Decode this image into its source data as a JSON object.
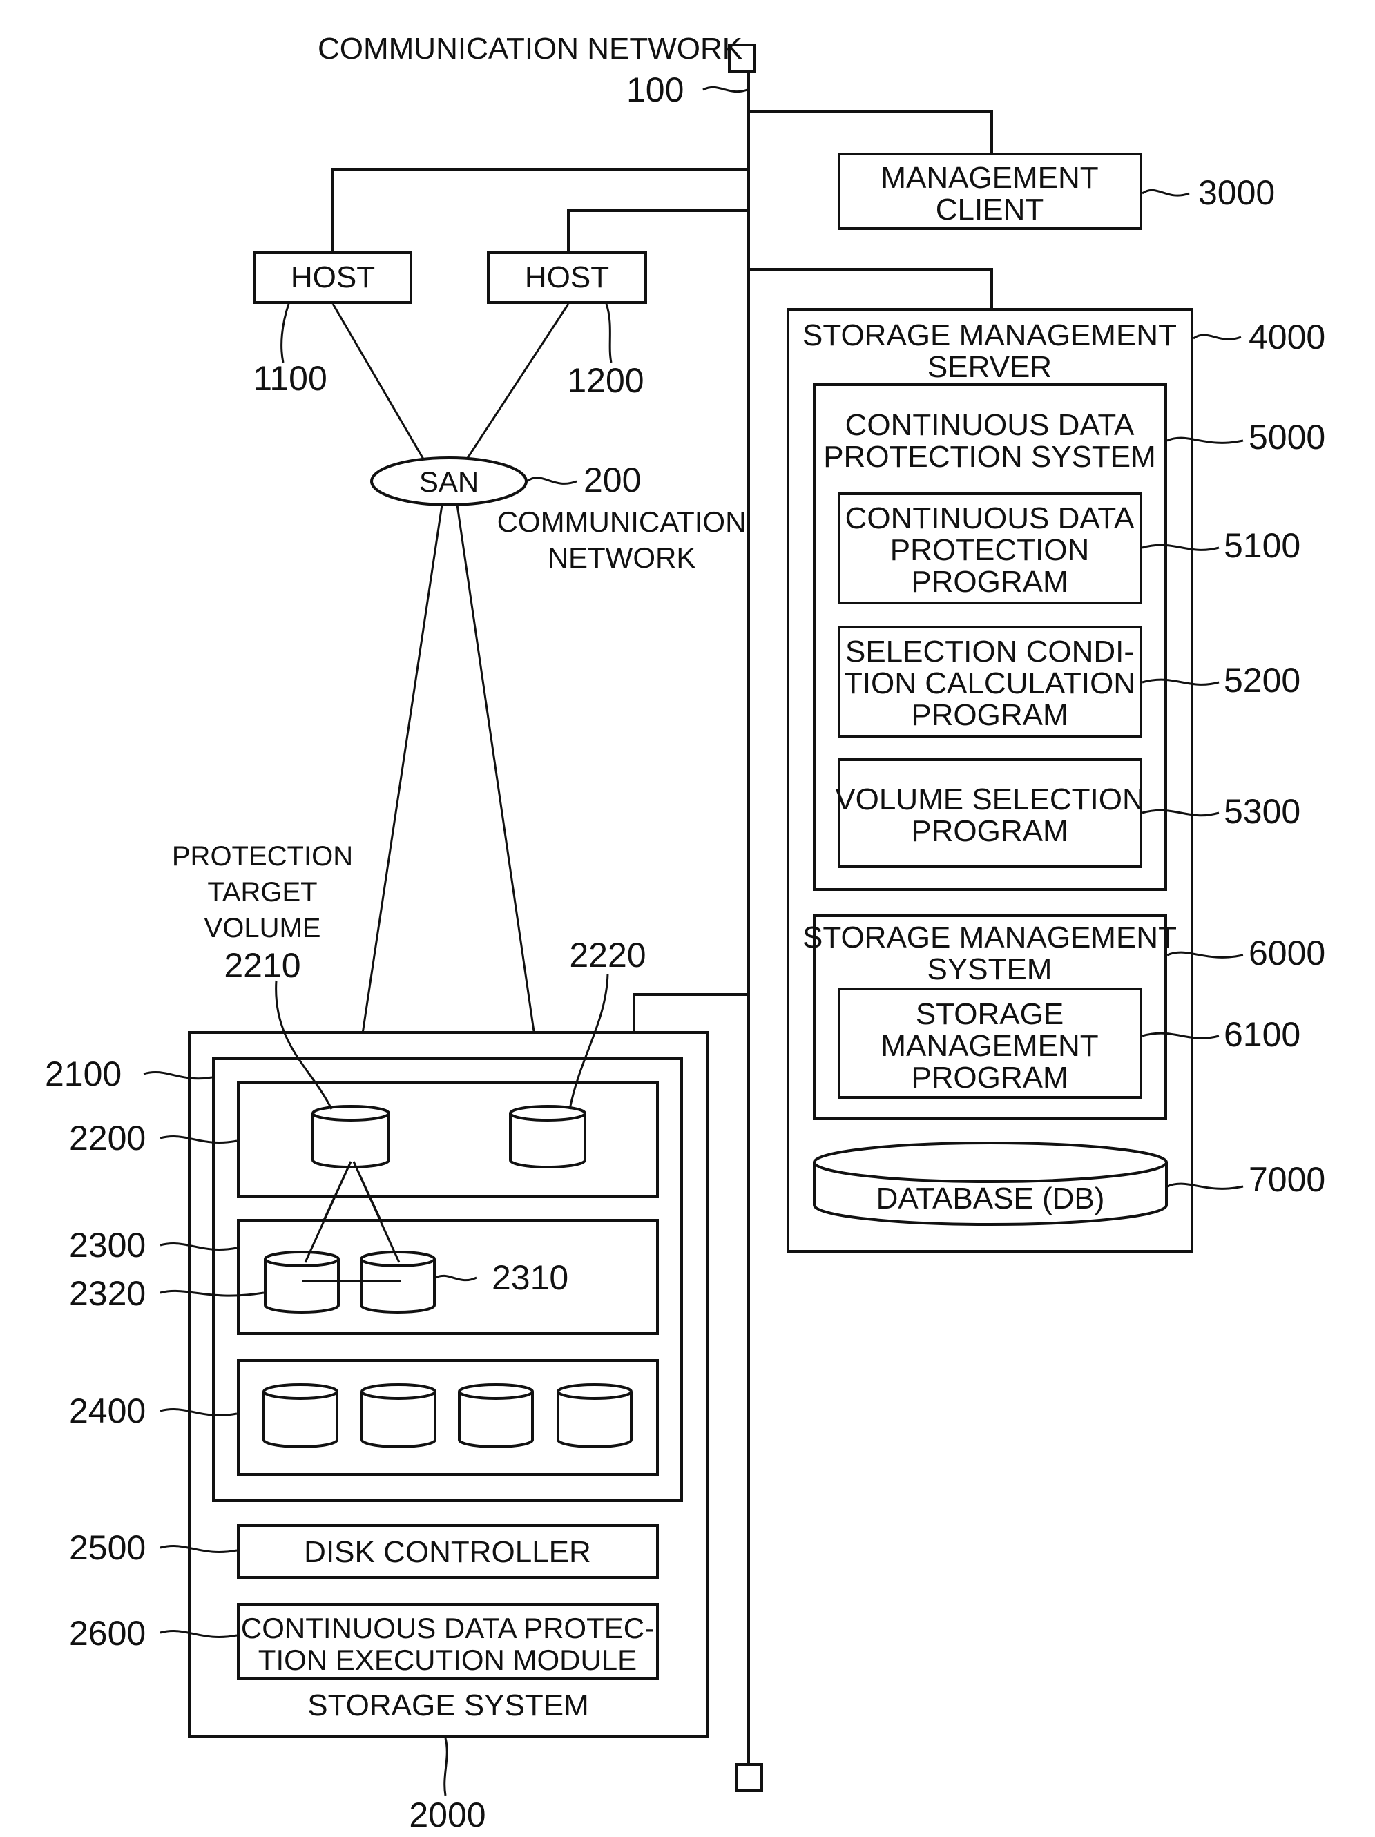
{
  "network": {
    "title": "COMMUNICATION NETWORK",
    "ref": "100"
  },
  "hosts": [
    {
      "label": "HOST",
      "ref": "1100"
    },
    {
      "label": "HOST",
      "ref": "1200"
    }
  ],
  "san": {
    "label": "SAN",
    "ref": "200",
    "caption_line1": "COMMUNICATION",
    "caption_line2": "NETWORK"
  },
  "management_client": {
    "line1": "MANAGEMENT",
    "line2": "CLIENT",
    "ref": "3000"
  },
  "server": {
    "line1": "STORAGE MANAGEMENT",
    "line2": "SERVER",
    "ref": "4000",
    "cdp_system": {
      "line1": "CONTINUOUS DATA",
      "line2": "PROTECTION SYSTEM",
      "ref": "5000",
      "programs": [
        {
          "lines": [
            "CONTINUOUS DATA",
            "PROTECTION",
            "PROGRAM"
          ],
          "ref": "5100"
        },
        {
          "lines": [
            "SELECTION CONDI-",
            "TION CALCULATION",
            "PROGRAM"
          ],
          "ref": "5200"
        },
        {
          "lines": [
            "VOLUME SELECTION",
            "PROGRAM"
          ],
          "ref": "5300"
        }
      ]
    },
    "sms": {
      "line1": "STORAGE MANAGEMENT",
      "line2": "SYSTEM",
      "ref": "6000",
      "program": {
        "lines": [
          "STORAGE",
          "MANAGEMENT",
          "PROGRAM"
        ],
        "ref": "6100"
      }
    },
    "database": {
      "label": "DATABASE (DB)",
      "ref": "7000"
    }
  },
  "storage": {
    "label": "STORAGE SYSTEM",
    "ref": "2000",
    "ref_2100": "2100",
    "ref_2200": "2200",
    "ref_2300": "2300",
    "ref_2320": "2320",
    "ref_2310": "2310",
    "ref_2400": "2400",
    "protection_target": {
      "line1": "PROTECTION",
      "line2": "TARGET",
      "line3": "VOLUME",
      "ref": "2210"
    },
    "ref_2220": "2220",
    "disk_controller": {
      "label": "DISK CONTROLLER",
      "ref": "2500"
    },
    "cdp_module": {
      "line1": "CONTINUOUS DATA PROTEC-",
      "line2": "TION EXECUTION MODULE",
      "ref": "2600"
    }
  }
}
